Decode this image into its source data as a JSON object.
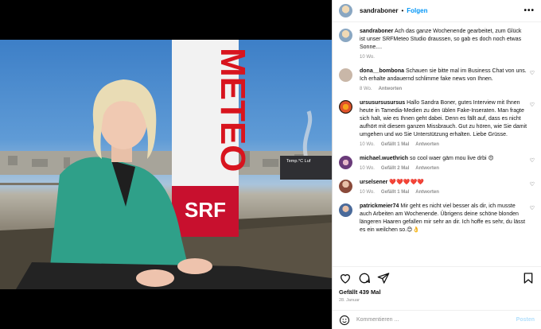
{
  "media": {
    "sign_text": "METEO",
    "sign_brand": "SRF",
    "corner_label": "Temp.°C   Luf"
  },
  "post": {
    "username": "sandraboner",
    "separator": "•",
    "follow_label": "Folgen",
    "more_label": "•••",
    "caption": "Ach das ganze Wochenende gearbeitet, zum Glück ist unser SRFMeteo Studio draussen, so gab es doch noch etwas Sonne....",
    "caption_age": "10 Wo.",
    "likes": "Gefällt 439 Mal",
    "date": "28. Januar",
    "comment_placeholder": "Kommentieren ...",
    "post_label": "Posten"
  },
  "comments": [
    {
      "user": "dona__bombona",
      "text": "Schauen sie bitte mal im Business Chat von uns. Ich erhalte andauernd schlimme fake news von Ihnen.",
      "age": "8 Wo.",
      "likes": "",
      "reply": "Antworten",
      "avatar_color": "#c9b7a8"
    },
    {
      "user": "ursusursusursus",
      "text": "Hallo Sandra Boner, gutes Interview mit Ihnen heute in Tamedia-Medien zu den üblen Fake-Inseraten. Man fragte sich halt, wie es Ihnen geht dabei. Denn es fällt auf, dass es nicht aufhört mit diesem ganzen Missbrauch. Gut zu hören, wie Sie damit umgehen und wo Sie Unterstützung erhalten. Liebe Grüsse.",
      "age": "10 Wo.",
      "likes": "Gefällt 1 Mal",
      "reply": "Antworten",
      "avatar_color": "#e0542a"
    },
    {
      "user": "michael.wuethrich",
      "text": "so cool waer gäm mou live drbi 😍",
      "age": "10 Wo.",
      "likes": "Gefällt 2 Mal",
      "reply": "Antworten",
      "avatar_color": "#6a3b7a"
    },
    {
      "user": "urselsener",
      "text": "❤️❤️❤️❤️❤️",
      "age": "10 Wo.",
      "likes": "Gefällt 1 Mal",
      "reply": "Antworten",
      "avatar_color": "#8a4a3a"
    },
    {
      "user": "patrickmeier74",
      "text": "Mir geht es nicht viel besser als dir, ich musste auch Arbeiten am Wochenende. Übrigens deine schöne blonden längeren Haaren gefallen mir sehr an dir. Ich hoffe es sehr, du lässt es ein weilchen so.😊👌",
      "age": "",
      "likes": "",
      "reply": "",
      "avatar_color": "#4a6a9a"
    }
  ],
  "colors": {
    "accent": "#0095f6",
    "muted": "#8e8e8e"
  }
}
